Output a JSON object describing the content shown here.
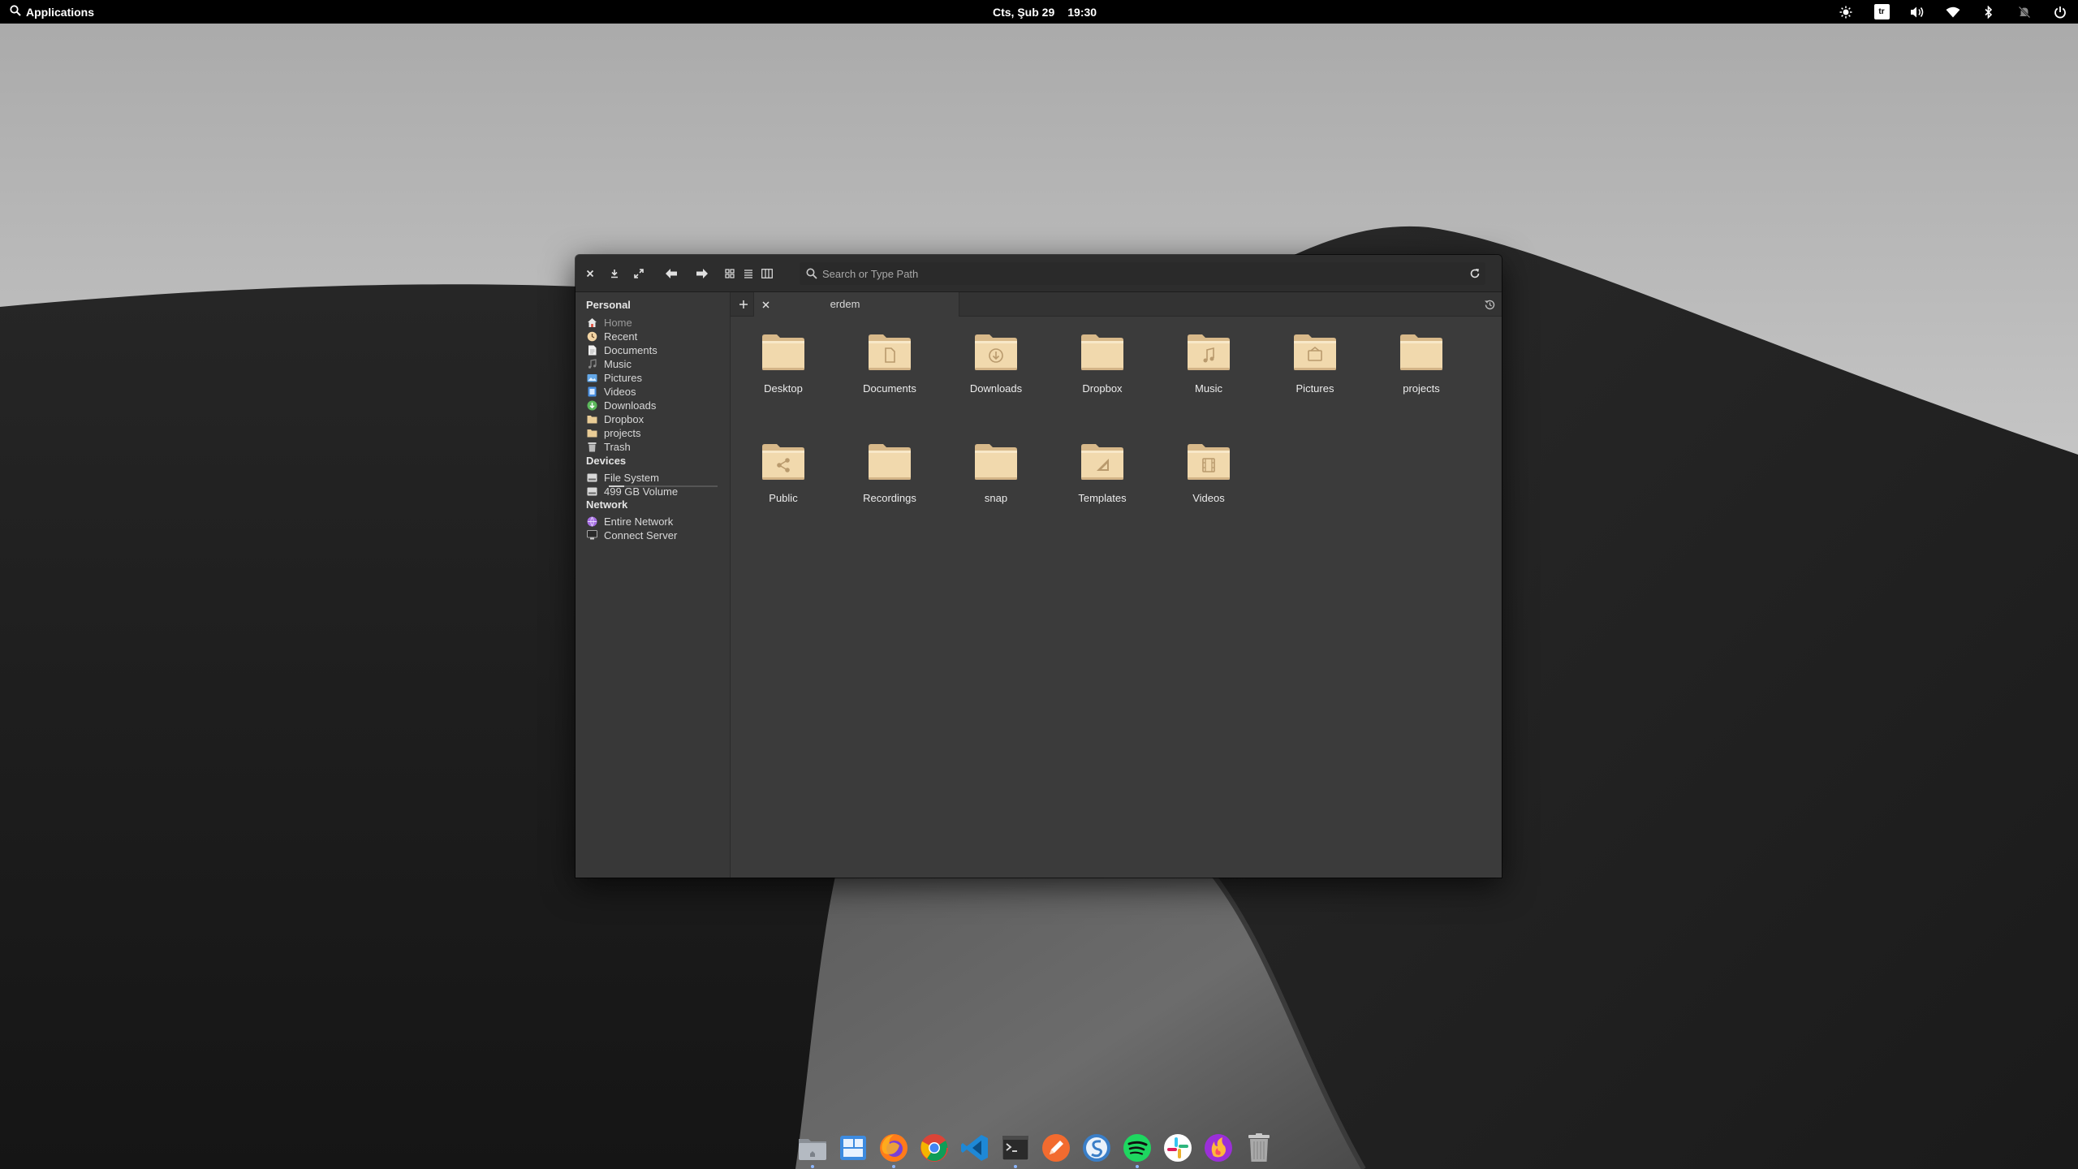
{
  "panel": {
    "applications_label": "Applications",
    "date": "Cts, Şub 29",
    "time": "19:30",
    "keyboard_layout": "tr",
    "indicators": [
      "night-light-icon",
      "keyboard-layout-icon",
      "volume-icon",
      "wifi-icon",
      "bluetooth-icon",
      "notifications-off-icon",
      "power-icon"
    ]
  },
  "window": {
    "headerbar": {
      "buttons": [
        "close-icon",
        "minimize-icon",
        "maximize-icon",
        "back-icon",
        "forward-icon",
        "grid-view-icon",
        "list-view-icon",
        "column-view-icon"
      ],
      "search_placeholder": "Search or Type Path"
    },
    "sidebar": {
      "personal_heading": "Personal",
      "personal": [
        {
          "label": "Home",
          "icon": "home-icon"
        },
        {
          "label": "Recent",
          "icon": "recent-icon"
        },
        {
          "label": "Documents",
          "icon": "documents-icon"
        },
        {
          "label": "Music",
          "icon": "music-icon"
        },
        {
          "label": "Pictures",
          "icon": "pictures-icon"
        },
        {
          "label": "Videos",
          "icon": "videos-icon"
        },
        {
          "label": "Downloads",
          "icon": "downloads-icon"
        },
        {
          "label": "Dropbox",
          "icon": "folder-icon"
        },
        {
          "label": "projects",
          "icon": "folder-icon"
        },
        {
          "label": "Trash",
          "icon": "trash-icon"
        }
      ],
      "devices_heading": "Devices",
      "devices": [
        {
          "label": "File System",
          "icon": "drive-icon",
          "usage": 0.14
        },
        {
          "label": "499 GB Volume",
          "icon": "drive-icon"
        }
      ],
      "network_heading": "Network",
      "network": [
        {
          "label": "Entire Network",
          "icon": "network-icon"
        },
        {
          "label": "Connect Server",
          "icon": "server-icon"
        }
      ]
    },
    "tab": {
      "label": "erdem"
    },
    "files": [
      {
        "name": "Desktop",
        "emblem": "none"
      },
      {
        "name": "Documents",
        "emblem": "document"
      },
      {
        "name": "Downloads",
        "emblem": "download"
      },
      {
        "name": "Dropbox",
        "emblem": "none"
      },
      {
        "name": "Music",
        "emblem": "music"
      },
      {
        "name": "Pictures",
        "emblem": "picture"
      },
      {
        "name": "projects",
        "emblem": "none"
      },
      {
        "name": "Public",
        "emblem": "share"
      },
      {
        "name": "Recordings",
        "emblem": "none"
      },
      {
        "name": "snap",
        "emblem": "none"
      },
      {
        "name": "Templates",
        "emblem": "template"
      },
      {
        "name": "Videos",
        "emblem": "video"
      }
    ]
  },
  "dock": {
    "apps": [
      {
        "name": "Files",
        "icon": "files-icon",
        "running": true
      },
      {
        "name": "Multitasking View",
        "icon": "multitasking-icon",
        "running": false
      },
      {
        "name": "Firefox",
        "icon": "firefox-icon",
        "running": true
      },
      {
        "name": "Chrome",
        "icon": "chrome-icon",
        "running": false
      },
      {
        "name": "Visual Studio Code",
        "icon": "vscode-icon",
        "running": false
      },
      {
        "name": "Terminal",
        "icon": "terminal-icon",
        "running": true
      },
      {
        "name": "Sketch",
        "icon": "pencil-app-icon",
        "running": false
      },
      {
        "name": "Simplenote",
        "icon": "simplenote-icon",
        "running": false
      },
      {
        "name": "Spotify",
        "icon": "spotify-icon",
        "running": true
      },
      {
        "name": "Slack",
        "icon": "slack-icon",
        "running": false
      },
      {
        "name": "Firefox Nightly",
        "icon": "nightly-icon",
        "running": false
      },
      {
        "name": "Trash",
        "icon": "trash-can-icon",
        "running": false
      }
    ]
  },
  "colors": {
    "panel": "#000000",
    "headerbar": "#2d2d2d",
    "sidebar": "#383838",
    "content": "#3b3b3b",
    "folder": "#f1d9ad",
    "folder_emblem": "#b99a6d"
  }
}
